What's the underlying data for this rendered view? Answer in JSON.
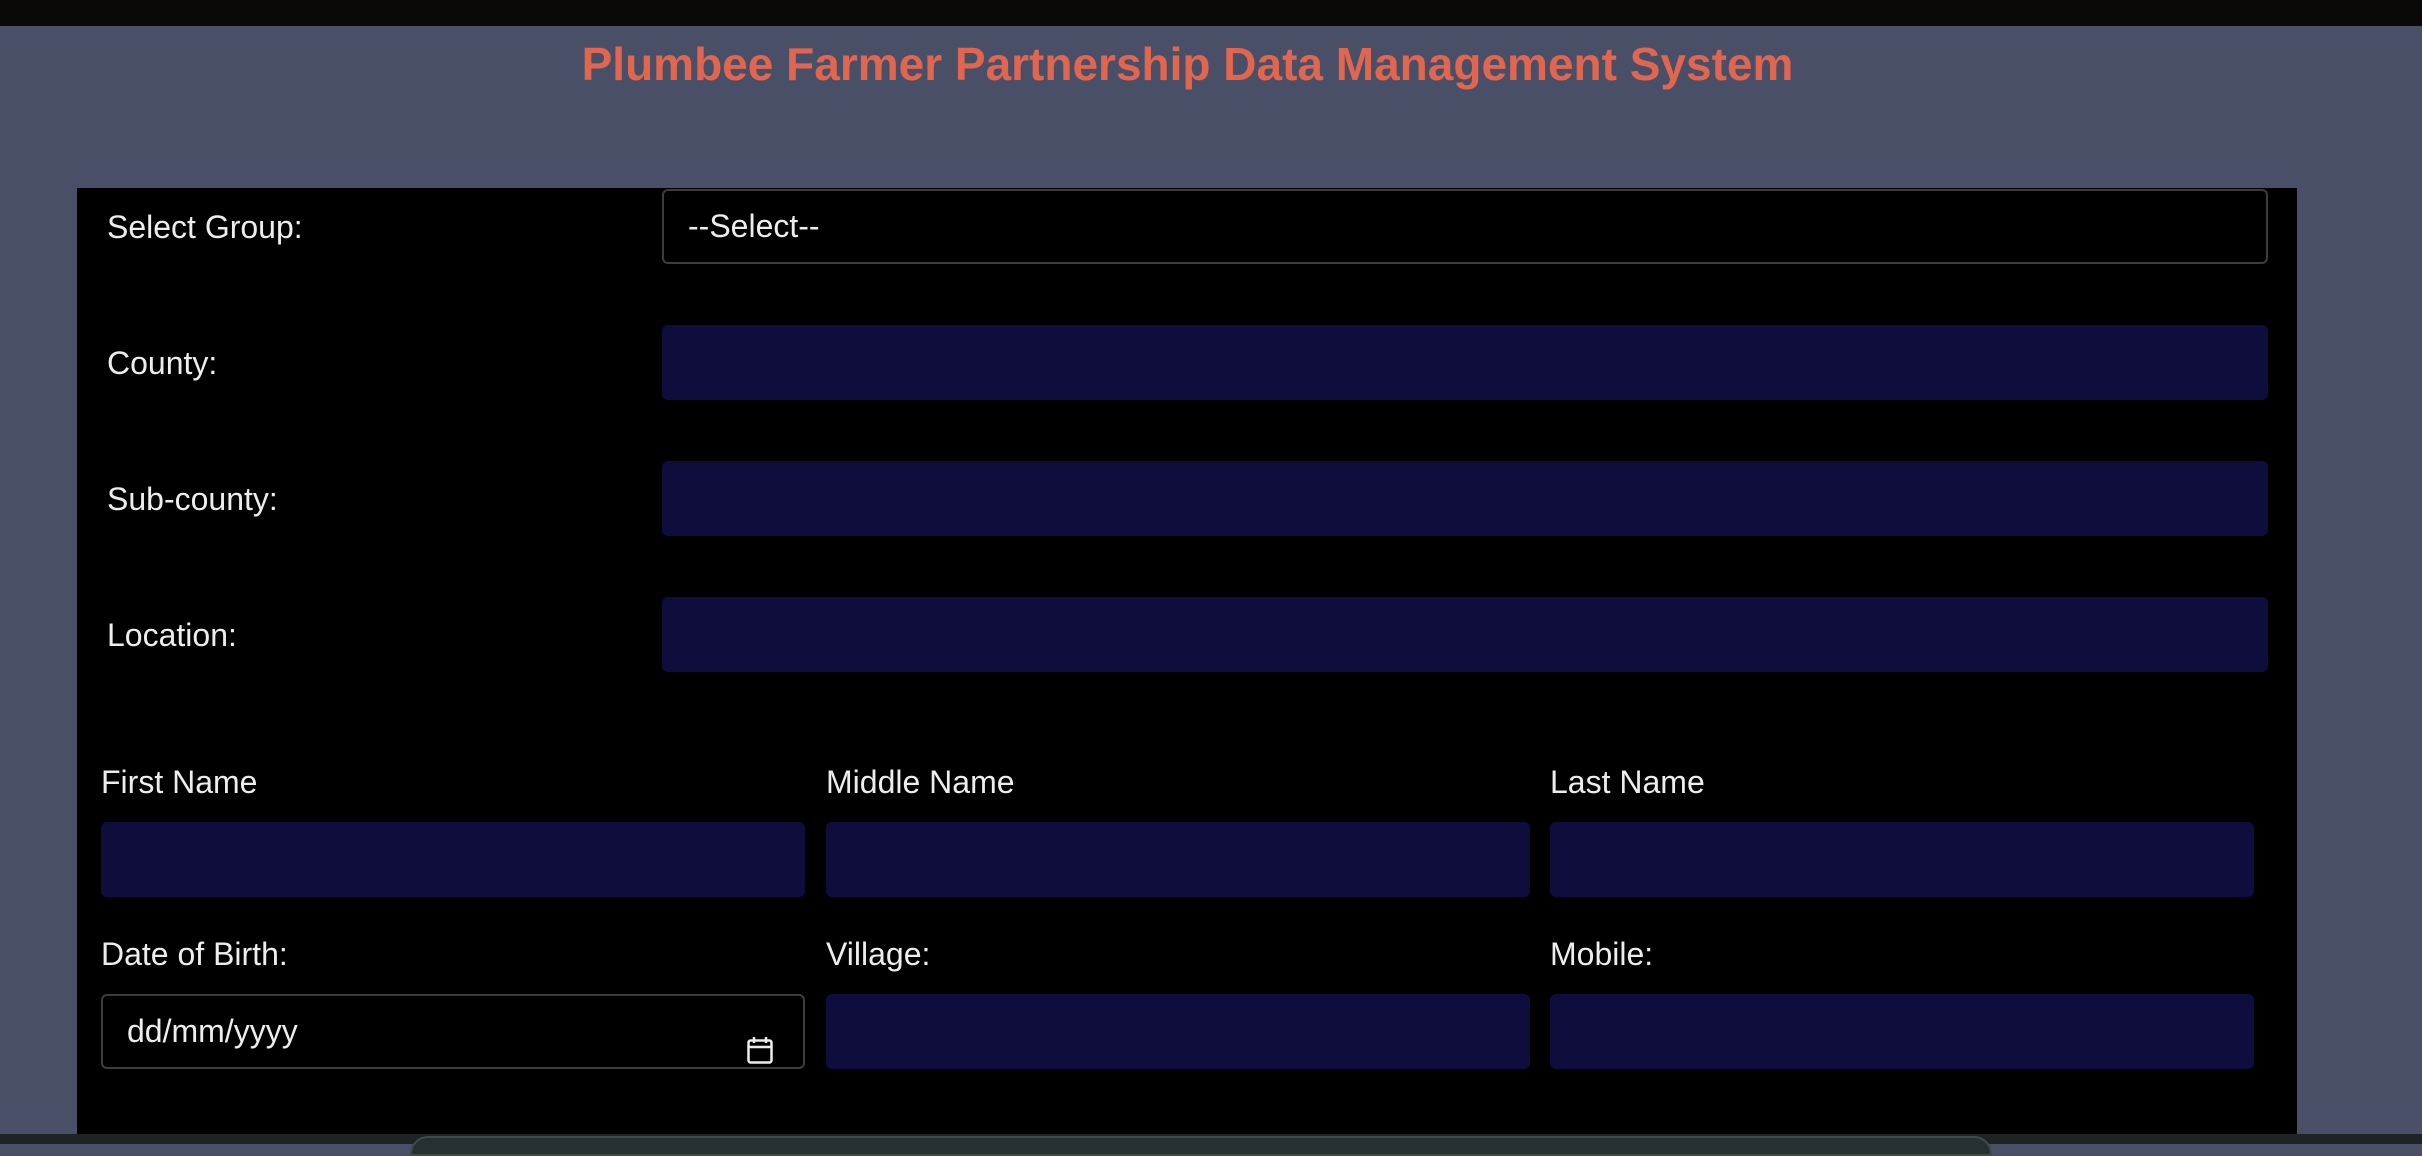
{
  "header": {
    "title": "Plumbee Farmer Partnership Data Management System"
  },
  "form": {
    "group": {
      "label": "Select Group:",
      "selected": "--Select--"
    },
    "county": {
      "label": "County:",
      "value": ""
    },
    "subcounty": {
      "label": "Sub-county:",
      "value": ""
    },
    "location": {
      "label": "Location:",
      "value": ""
    },
    "first_name": {
      "label": "First Name",
      "value": ""
    },
    "middle_name": {
      "label": "Middle Name",
      "value": ""
    },
    "last_name": {
      "label": "Last Name",
      "value": ""
    },
    "dob": {
      "label": "Date of Birth:",
      "placeholder": "dd/mm/yyyy"
    },
    "village": {
      "label": "Village:",
      "value": ""
    },
    "mobile": {
      "label": "Mobile:",
      "value": ""
    }
  },
  "icons": {
    "date_picker": "calendar-icon"
  },
  "colors": {
    "page_background": "#4a4f68",
    "title": "#e0664f",
    "panel_background": "#000000",
    "input_background": "#0e0d3e",
    "label_text": "#ededed"
  }
}
